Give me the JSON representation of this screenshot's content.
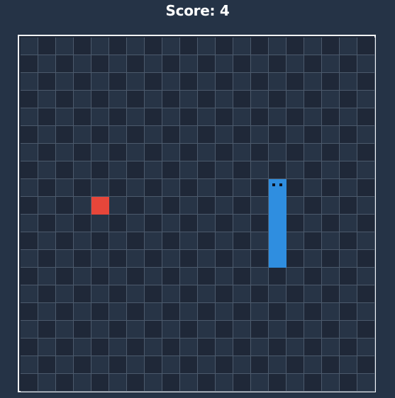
{
  "header": {
    "score_text": "Score: 4"
  },
  "game": {
    "grid_cols": 20,
    "grid_rows": 20,
    "food": {
      "col": 4,
      "row": 9
    },
    "snake": [
      {
        "col": 14,
        "row": 8
      },
      {
        "col": 14,
        "row": 9
      },
      {
        "col": 14,
        "row": 10
      },
      {
        "col": 14,
        "row": 11
      },
      {
        "col": 14,
        "row": 12
      }
    ],
    "direction": "up",
    "colors": {
      "background": "#253346",
      "cell_dark": "#1f2838",
      "cell_light": "#273446",
      "grid_line": "#4c5a6c",
      "border": "#f2f4f7",
      "food": "#e7463a",
      "snake": "#2f8ee0",
      "eyes": "#0b1220"
    }
  }
}
